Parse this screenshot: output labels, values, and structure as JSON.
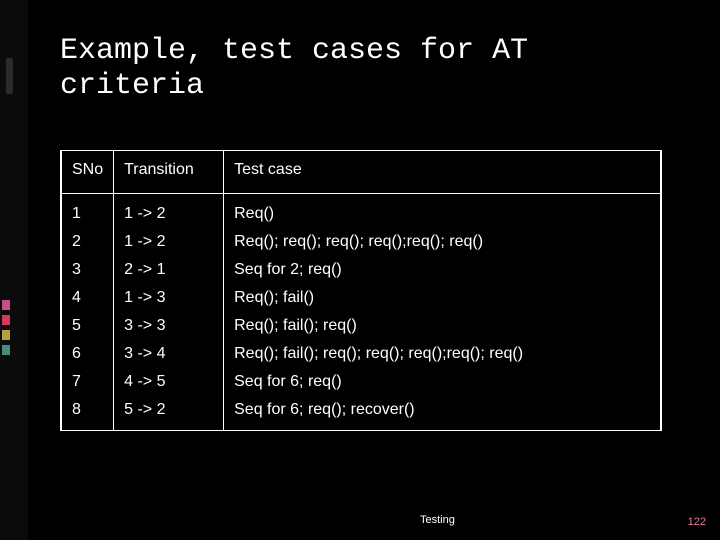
{
  "title": "Example, test cases for AT criteria",
  "columns": {
    "sno": "SNo",
    "transition": "Transition",
    "testcase": "Test case"
  },
  "rows": [
    {
      "sno": "1",
      "transition": "1 -> 2",
      "testcase": "Req()"
    },
    {
      "sno": "2",
      "transition": "1 -> 2",
      "testcase": "Req(); req(); req(); req();req(); req()"
    },
    {
      "sno": "3",
      "transition": "2 -> 1",
      "testcase": "Seq for 2; req()"
    },
    {
      "sno": "4",
      "transition": "1 -> 3",
      "testcase": "Req(); fail()"
    },
    {
      "sno": "5",
      "transition": "3 -> 3",
      "testcase": "Req(); fail(); req()"
    },
    {
      "sno": "6",
      "transition": "3 -> 4",
      "testcase": "Req(); fail(); req(); req(); req();req(); req()"
    },
    {
      "sno": "7",
      "transition": "4 -> 5",
      "testcase": "Seq for 6; req()"
    },
    {
      "sno": "8",
      "transition": "5 -> 2",
      "testcase": "Seq for 6; req(); recover()"
    }
  ],
  "footer": "Testing",
  "page": "122"
}
